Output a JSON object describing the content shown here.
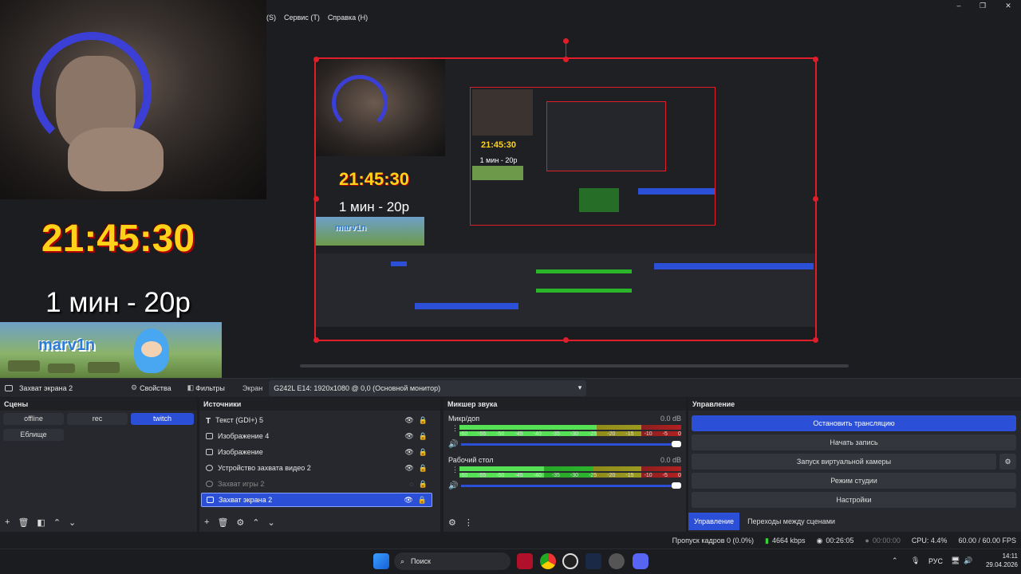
{
  "menu": {
    "item1": "(S)",
    "item2": "Сервис (T)",
    "item3": "Справка (H)"
  },
  "window_controls": {
    "minimize": "–",
    "maximize": "❐",
    "close": "✕"
  },
  "overlay": {
    "clock": "21:45:30",
    "price": "1 мин - 20р",
    "banner": "marv1n"
  },
  "nested_preview": {
    "clock": "21:45:30",
    "price": "1 мин - 20р",
    "banner": "marv1n"
  },
  "nested_preview_small": {
    "clock": "21:45:30",
    "price": "1 мин - 20р"
  },
  "source_bar": {
    "selected_source": "Захват экрана 2",
    "properties": "Свойства",
    "filters": "Фильтры",
    "screen_label": "Экран",
    "screen_value": "G242L E14: 1920x1080 @ 0,0 (Основной монитор)"
  },
  "scenes": {
    "title": "Сцены",
    "items": [
      "offline",
      "rec",
      "twitch",
      "Еблище"
    ],
    "active": "twitch"
  },
  "sources": {
    "title": "Источники",
    "items": [
      {
        "label": "Текст (GDI+) 5",
        "icon": "text-icon"
      },
      {
        "label": "Изображение 4",
        "icon": "image-icon"
      },
      {
        "label": "Изображение",
        "icon": "image-icon"
      },
      {
        "label": "Устройство захвата видео 2",
        "icon": "camera-icon"
      },
      {
        "label": "Захват игры 2",
        "icon": "gamepad-icon"
      },
      {
        "label": "Захват экрана 2",
        "icon": "monitor-icon"
      }
    ]
  },
  "mixer": {
    "title": "Микшер звука",
    "channels": [
      {
        "name": "Микр/доп",
        "db": "0.0 dB",
        "level": 0.62
      },
      {
        "name": "Рабочий стол",
        "db": "0.0 dB",
        "level": 0.38
      }
    ],
    "ticks": [
      "-60",
      "-55",
      "-50",
      "-45",
      "-40",
      "-35",
      "-30",
      "-25",
      "-20",
      "-15",
      "-10",
      "-5",
      "0"
    ]
  },
  "controls": {
    "title": "Управление",
    "stop_stream": "Остановить трансляцию",
    "start_record": "Начать запись",
    "virtual_cam": "Запуск виртуальной камеры",
    "studio_mode": "Режим студии",
    "settings": "Настройки",
    "tab_controls": "Управление",
    "tab_transitions": "Переходы между сценами"
  },
  "status": {
    "dropped": "Пропуск кадров 0 (0.0%)",
    "bitrate": "4664 kbps",
    "live_time": "00:26:05",
    "rec_time": "00:00:00",
    "cpu": "CPU: 4.4%",
    "fps": "60.00 / 60.00 FPS"
  },
  "taskbar": {
    "search": "Поиск",
    "lang": "РУС",
    "time": "14:11",
    "date": "29.04.2026"
  },
  "colors": {
    "accent": "#2b4fd6",
    "selection": "#e11d2a",
    "clock": "#ffd21a"
  }
}
